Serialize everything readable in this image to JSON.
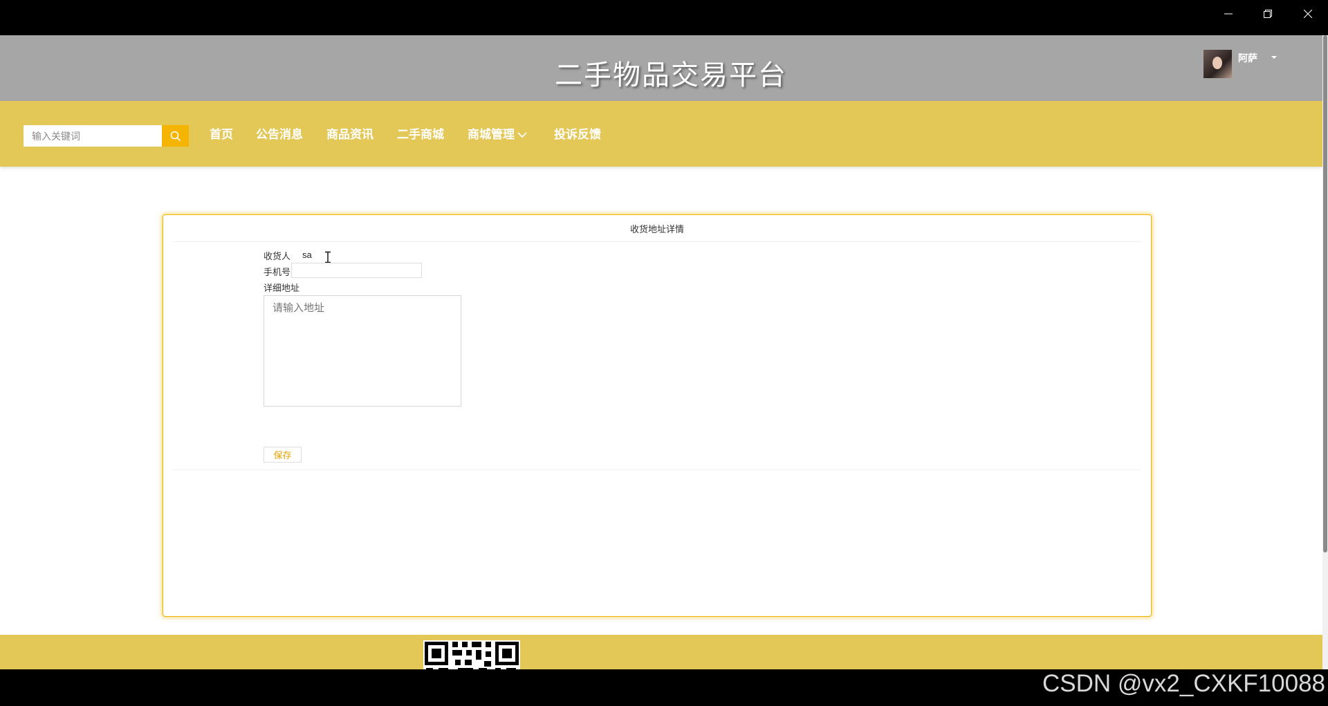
{
  "site": {
    "title": "二手物品交易平台"
  },
  "user": {
    "name": "阿萨"
  },
  "search": {
    "placeholder": "输入关键词",
    "value": ""
  },
  "nav": {
    "items": [
      {
        "label": "首页"
      },
      {
        "label": "公告消息"
      },
      {
        "label": "商品资讯"
      },
      {
        "label": "二手商城"
      },
      {
        "label": "商城管理"
      },
      {
        "label": "投诉反馈"
      }
    ]
  },
  "form": {
    "title": "收货地址详情",
    "consignee_label": "收货人",
    "consignee_value": "sa",
    "phone_label": "手机号",
    "phone_value": "",
    "address_label": "详细地址",
    "address_placeholder": "请输入地址",
    "save_label": "保存"
  },
  "watermark": "CSDN @vx2_CXKF10088",
  "colors": {
    "header_gray": "#a6a6a6",
    "accent_yellow": "#e3c757",
    "button_orange": "#f5b400"
  }
}
